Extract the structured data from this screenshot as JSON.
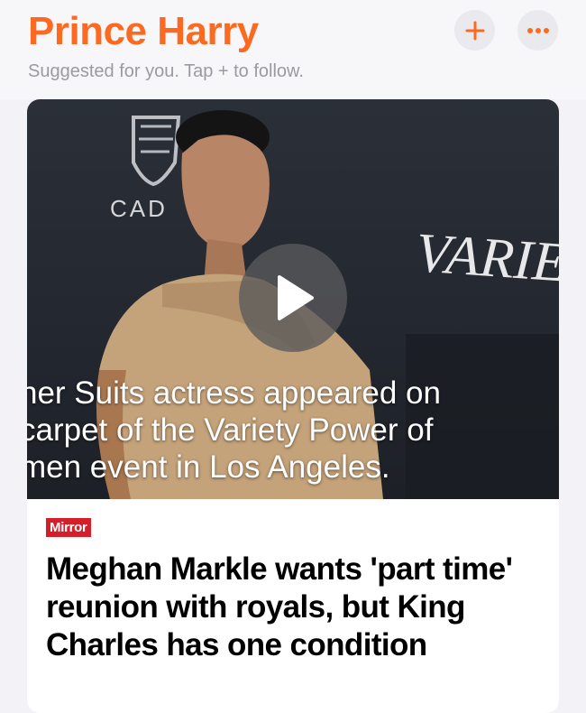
{
  "header": {
    "title": "Prince Harry",
    "subtitle": "Suggested for you. Tap + to follow.",
    "follow_icon": "plus-icon",
    "more_icon": "ellipsis-icon",
    "accent_color": "#fb6a20"
  },
  "article": {
    "video_caption_lines": [
      "her Suits actress appeared on",
      "carpet of the Variety Power of",
      "men event in Los Angeles."
    ],
    "background_text_left": "CAD",
    "background_text_right": "VARIET",
    "play_icon": "play-icon",
    "source": "Mirror",
    "source_color": "#d21f2a",
    "headline": "Meghan Markle wants 'part time' reunion with royals, but King Charles has one condition"
  }
}
